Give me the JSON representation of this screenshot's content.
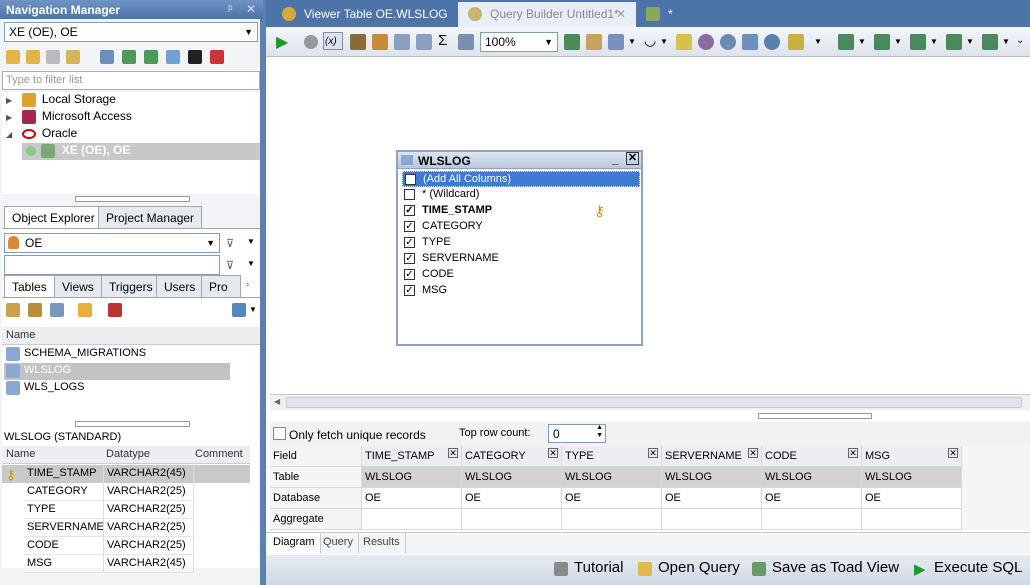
{
  "nav": {
    "title": "Navigation Manager",
    "connection": "XE (OE), OE",
    "filter_placeholder": "Type to filter list",
    "tree": [
      {
        "label": "Local Storage"
      },
      {
        "label": "Microsoft Access"
      },
      {
        "label": "Oracle"
      },
      {
        "label": "XE (OE), OE"
      }
    ]
  },
  "explorer": {
    "tabs": [
      "Object Explorer",
      "Project Manager"
    ],
    "schema": "OE",
    "subtabs": [
      "Tables",
      "Views",
      "Triggers",
      "Users",
      "Pro"
    ],
    "list_header": "Name",
    "tables": [
      "SCHEMA_MIGRATIONS",
      "WLSLOG",
      "WLS_LOGS"
    ],
    "detail_title": "WLSLOG (STANDARD)",
    "detail_headers": [
      "Name",
      "Datatype",
      "Comment"
    ],
    "detail_rows": [
      {
        "name": "TIME_STAMP",
        "type": "VARCHAR2(45)"
      },
      {
        "name": "CATEGORY",
        "type": "VARCHAR2(25)"
      },
      {
        "name": "TYPE",
        "type": "VARCHAR2(25)"
      },
      {
        "name": "SERVERNAME",
        "type": "VARCHAR2(25)"
      },
      {
        "name": "CODE",
        "type": "VARCHAR2(25)"
      },
      {
        "name": "MSG",
        "type": "VARCHAR2(45)"
      }
    ]
  },
  "doctabs": [
    {
      "label": "Viewer Table OE.WLSLOG"
    },
    {
      "label": "Query Builder Untitled1*"
    },
    {
      "label": "*"
    }
  ],
  "toolbar": {
    "zoom": "100%"
  },
  "table_window": {
    "title": "WLSLOG",
    "columns": [
      {
        "label": "(Add All Columns)",
        "checked": true
      },
      {
        "label": "* (Wildcard)",
        "checked": false
      },
      {
        "label": "TIME_STAMP",
        "checked": true
      },
      {
        "label": "CATEGORY",
        "checked": true
      },
      {
        "label": "TYPE",
        "checked": true
      },
      {
        "label": "SERVERNAME",
        "checked": true
      },
      {
        "label": "CODE",
        "checked": true
      },
      {
        "label": "MSG",
        "checked": true
      }
    ]
  },
  "options": {
    "unique_label": "Only fetch unique records",
    "top_row_label": "Top row count:",
    "top_row_value": "0"
  },
  "query_grid": {
    "row_labels": [
      "Field",
      "Table",
      "Database",
      "Aggregate"
    ],
    "columns": [
      {
        "field": "TIME_STAMP",
        "table": "WLSLOG",
        "db": "OE"
      },
      {
        "field": "CATEGORY",
        "table": "WLSLOG",
        "db": "OE"
      },
      {
        "field": "TYPE",
        "table": "WLSLOG",
        "db": "OE"
      },
      {
        "field": "SERVERNAME",
        "table": "WLSLOG",
        "db": "OE"
      },
      {
        "field": "CODE",
        "table": "WLSLOG",
        "db": "OE"
      },
      {
        "field": "MSG",
        "table": "WLSLOG",
        "db": "OE"
      }
    ]
  },
  "bottom_tabs": [
    "Diagram",
    "Query",
    "Results"
  ],
  "actions": {
    "tutorial": "Tutorial",
    "open_query": "Open Query",
    "save_toad": "Save as Toad View",
    "execute": "Execute SQL"
  }
}
